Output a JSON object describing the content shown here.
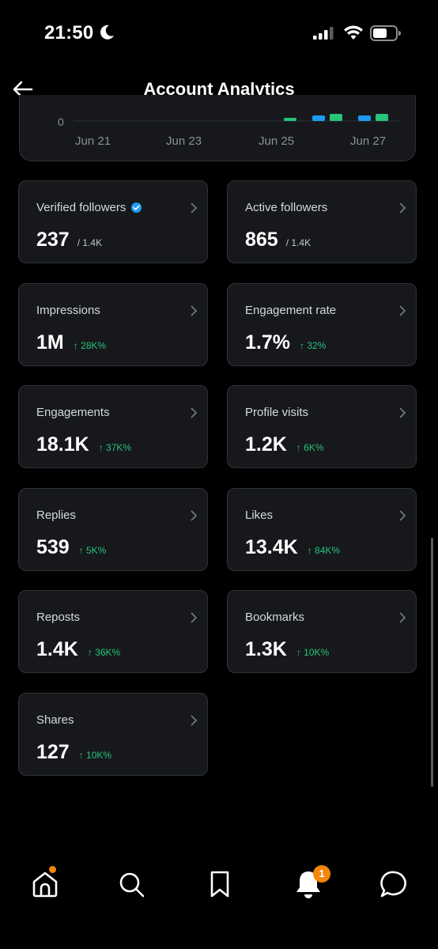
{
  "status": {
    "time": "21:50"
  },
  "header": {
    "title": "Account Analytics"
  },
  "chart": {
    "y_zero": "0",
    "x_labels": [
      "Jun 21",
      "Jun 23",
      "Jun 25",
      "Jun 27"
    ]
  },
  "cards": [
    {
      "label": "Verified followers",
      "value": "237",
      "sub": "/ 1.4K",
      "verified": true
    },
    {
      "label": "Active followers",
      "value": "865",
      "sub": "/ 1.4K"
    },
    {
      "label": "Impressions",
      "value": "1M",
      "delta": "↑ 28K%"
    },
    {
      "label": "Engagement rate",
      "value": "1.7%",
      "delta": "↑ 32%"
    },
    {
      "label": "Engagements",
      "value": "18.1K",
      "delta": "↑ 37K%"
    },
    {
      "label": "Profile visits",
      "value": "1.2K",
      "delta": "↑ 6K%"
    },
    {
      "label": "Replies",
      "value": "539",
      "delta": "↑ 5K%"
    },
    {
      "label": "Likes",
      "value": "13.4K",
      "delta": "↑ 84K%"
    },
    {
      "label": "Reposts",
      "value": "1.4K",
      "delta": "↑ 36K%"
    },
    {
      "label": "Bookmarks",
      "value": "1.3K",
      "delta": "↑ 10K%"
    },
    {
      "label": "Shares",
      "value": "127",
      "delta": "↑ 10K%"
    }
  ],
  "tabbar": {
    "notifications_count": "1",
    "icons": [
      "home-icon",
      "search-icon",
      "bookmark-icon",
      "bell-icon",
      "messages-icon"
    ]
  },
  "colors": {
    "accent_green": "#27c47a",
    "accent_blue": "#1d9bf0",
    "badge_orange": "#f4860a"
  }
}
